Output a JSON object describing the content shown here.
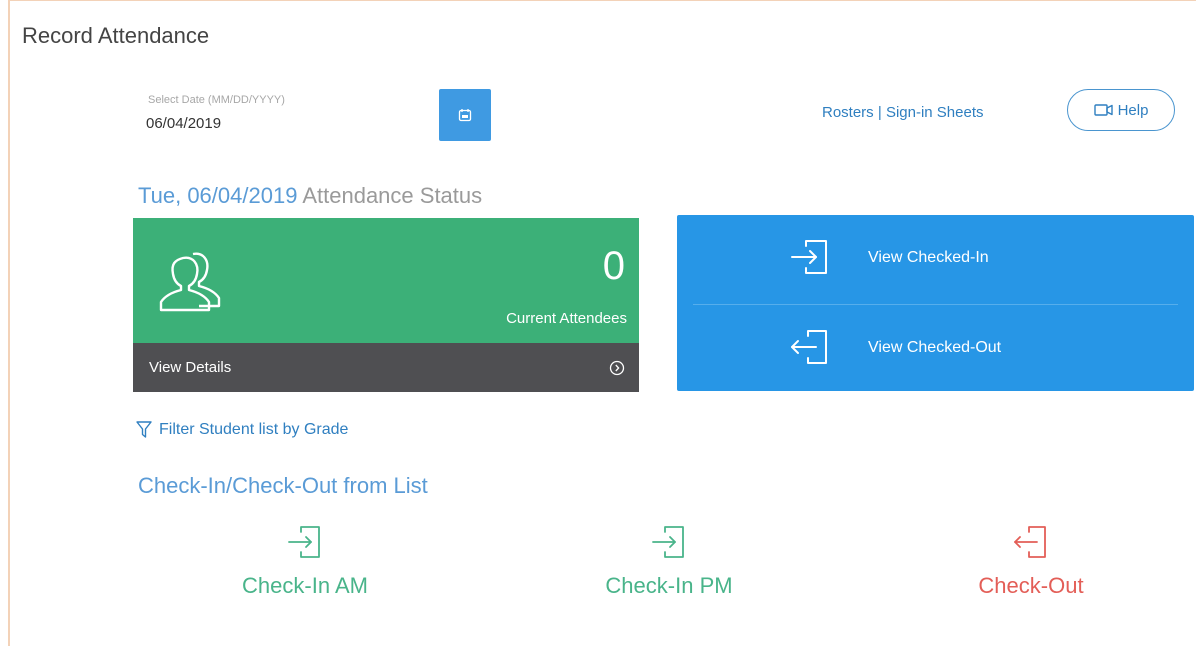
{
  "page": {
    "title": "Record Attendance"
  },
  "date_picker": {
    "label": "Select Date (MM/DD/YYYY)",
    "value": "06/04/2019",
    "button_icon": "calendar-icon"
  },
  "top_links": {
    "rosters": "Rosters",
    "separator": "|",
    "sign_in_sheets": "Sign-in Sheets"
  },
  "help_button": {
    "label": "Help",
    "icon": "video-icon"
  },
  "status": {
    "heading_date": "Tue, 06/04/2019",
    "heading_rest": "Attendance Status"
  },
  "attendees_card": {
    "count": "0",
    "label": "Current Attendees",
    "details_label": "View Details",
    "icon": "people-icon",
    "color": "#3cb078"
  },
  "checked_card": {
    "checked_in_label": "View Checked-In",
    "checked_out_label": "View Checked-Out",
    "color": "#2796e6"
  },
  "filter": {
    "label": "Filter Student list by Grade",
    "icon": "filter-icon"
  },
  "list_section": {
    "heading": "Check-In/Check-Out from List",
    "actions": [
      {
        "label": "Check-In AM",
        "icon": "check-in-icon",
        "color": "#49b48a"
      },
      {
        "label": "Check-In PM",
        "icon": "check-in-icon",
        "color": "#49b48a"
      },
      {
        "label": "Check-Out",
        "icon": "check-out-icon",
        "color": "#e35e57"
      }
    ]
  }
}
